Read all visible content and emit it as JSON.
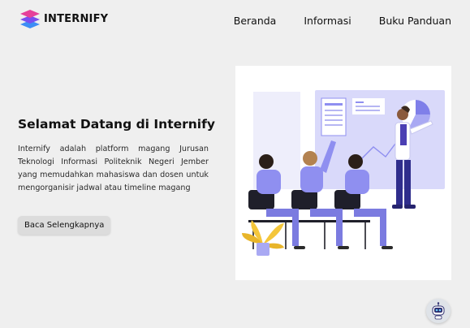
{
  "brand": {
    "name": "INTERNIFY",
    "logo_icon": "stacked-layers-logo",
    "colors": [
      "#e6409a",
      "#7a4df0",
      "#3d8df5"
    ]
  },
  "nav": {
    "items": [
      "Beranda",
      "Informasi",
      "Buku Panduan"
    ]
  },
  "hero": {
    "title": "Selamat Datang di Internify",
    "description": "Internify adalah platform magang Jurusan Teknologi Informasi Politeknik Negeri Jember yang memudahkan mahasiswa dan dosen untuk mengorganisir jadwal atau timeline magang",
    "cta_label": "Baca Selengkapnya"
  },
  "illustration": {
    "name": "presentation-classroom-illustration",
    "accent": "#8f8ff0"
  },
  "chatbot": {
    "icon": "robot-icon"
  }
}
